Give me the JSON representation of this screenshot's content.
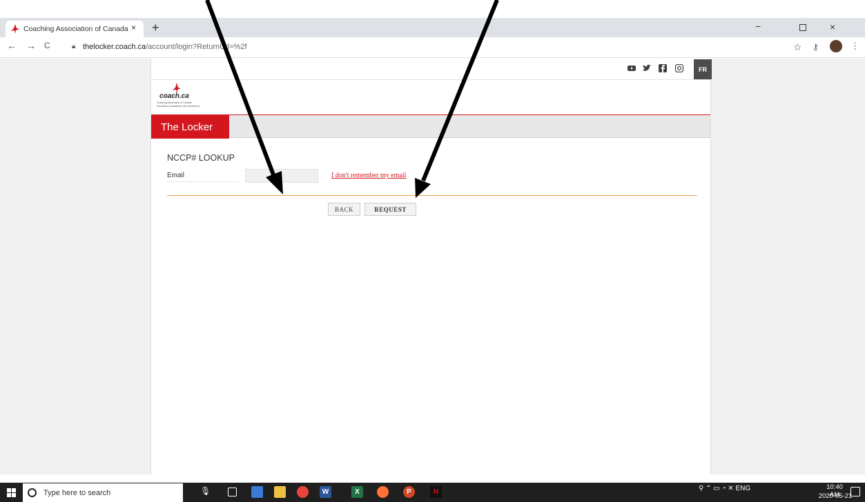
{
  "browser": {
    "tab_title": "Coaching Association of Canada",
    "tab_close": "×",
    "new_tab": "+",
    "url_domain": "thelocker.coach.ca",
    "url_path": "/account/login?ReturnUrl=%2f",
    "window_controls": {
      "minimize": "−",
      "close": "×"
    },
    "nav": {
      "back": "←",
      "forward": "→",
      "reload": "C"
    }
  },
  "site": {
    "logo_text": "coach.ca",
    "logo_sub1": "Coaching Association of Canada",
    "logo_sub2": "Association canadienne des entraîneurs",
    "section_title": "The Locker",
    "language_toggle": "FR",
    "social_icons": [
      "youtube-icon",
      "twitter-icon",
      "facebook-icon",
      "instagram-icon"
    ]
  },
  "form": {
    "title": "NCCP# LOOKUP",
    "email_label": "Email",
    "email_value": "",
    "forgot_link": "I don't remember my email",
    "back_button": "BACK",
    "request_button": "REQUEST"
  },
  "taskbar": {
    "search_placeholder": "Type here to search",
    "tray_lang": "ENG",
    "time": "10:40 AM",
    "date": "2020-05-21"
  },
  "colors": {
    "brand_red": "#d4171e",
    "accent_orange": "#f0a050",
    "taskbar": "#1f1f1f"
  }
}
